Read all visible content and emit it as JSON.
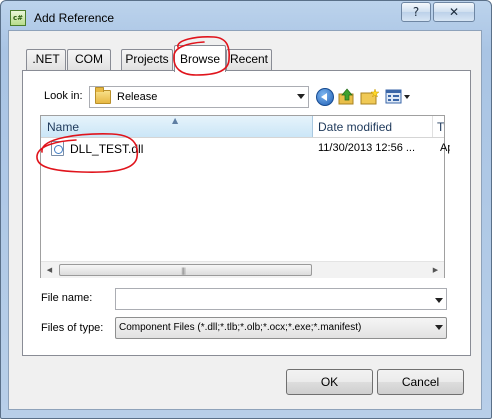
{
  "window": {
    "title": "Add Reference",
    "help_glyph": "?",
    "close_glyph": "✕",
    "app_icon_text": "c#"
  },
  "tabs": [
    {
      "label": ".NET",
      "active": false
    },
    {
      "label": "COM",
      "active": false
    },
    {
      "label": "Projects",
      "active": false
    },
    {
      "label": "Browse",
      "active": true
    },
    {
      "label": "Recent",
      "active": false
    }
  ],
  "look_in": {
    "label": "Look in:",
    "value": "Release",
    "folder_icon": "folder-icon"
  },
  "toolbar_icons": [
    "back-icon",
    "up-folder-icon",
    "new-folder-icon",
    "view-menu-icon"
  ],
  "file_list": {
    "columns": [
      "Name",
      "Date modified",
      "Ty"
    ],
    "rows": [
      {
        "name": "DLL_TEST.dll",
        "date": "11/30/2013 12:56 ...",
        "type": "Ap",
        "icon": "dll-file-icon"
      }
    ],
    "grip": "|||"
  },
  "file_name": {
    "label": "File name:",
    "value": ""
  },
  "file_type": {
    "label": "Files of type:",
    "value": "Component Files (*.dll;*.tlb;*.olb;*.ocx;*.exe;*.manifest)"
  },
  "buttons": {
    "ok": "OK",
    "cancel": "Cancel"
  },
  "colors": {
    "annotation_red": "#e0141c",
    "selection_header": "#cbe6f7"
  }
}
